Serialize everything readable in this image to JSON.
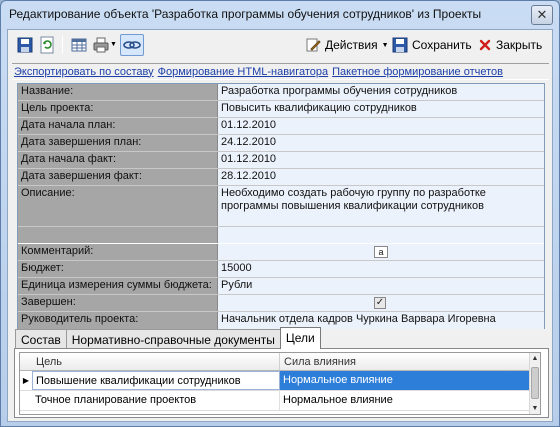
{
  "window": {
    "title": "Редактирование объекта 'Разработка программы обучения сотрудников' из Проекты",
    "close_glyph": "✕"
  },
  "toolbar": {
    "actions_label": "Действия",
    "save_label": "Сохранить",
    "close_label": "Закрыть",
    "icons": [
      "save-icon",
      "refresh-icon",
      "table-icon",
      "print-icon",
      "link-icon",
      "actions-icon",
      "save-icon",
      "close-icon"
    ]
  },
  "links": [
    "Экспортировать по составу",
    "Формирование HTML-навигатора",
    "Пакетное формирование отчетов"
  ],
  "properties": {
    "name": {
      "label": "Название:",
      "value": "Разработка программы обучения сотрудников"
    },
    "goal": {
      "label": "Цель проекта:",
      "value": "Повысить квалификацию сотрудников"
    },
    "start_plan": {
      "label": "Дата начала план:",
      "value": "01.12.2010"
    },
    "end_plan": {
      "label": "Дата завершения план:",
      "value": "24.12.2010"
    },
    "start_fact": {
      "label": "Дата начала факт:",
      "value": "01.12.2010"
    },
    "end_fact": {
      "label": "Дата завершения факт:",
      "value": "28.12.2010"
    },
    "description": {
      "label": "Описание:",
      "value": "Необходимо создать рабочую группу по разработке программы повышения квалификации сотрудников"
    },
    "comment": {
      "label": "Комментарий:",
      "value": "",
      "memo_glyph": "a"
    },
    "budget": {
      "label": "Бюджет:",
      "value": "15000"
    },
    "budget_unit": {
      "label": "Единица измерения суммы бюджета:",
      "value": "Рубли"
    },
    "completed": {
      "label": "Завершен:",
      "checked": true,
      "check_glyph": "✓"
    },
    "manager": {
      "label": "Руководитель проекта:",
      "value": "Начальник отдела кадров Чуркина Варвара Игоревна"
    }
  },
  "tabs": [
    "Состав",
    "Нормативно-справочные документы",
    "Цели"
  ],
  "active_tab": "Цели",
  "goals_table": {
    "columns": [
      "Цель",
      "Сила влияния"
    ],
    "rows": [
      {
        "goal": "Повышение квалификации сотрудников",
        "strength": "Нормальное влияние",
        "selected": true
      },
      {
        "goal": "Точное планирование проектов",
        "strength": "Нормальное влияние",
        "selected": false
      }
    ],
    "current_row_glyph": "▶"
  },
  "colors": {
    "title_gradient": "#c9dcf3",
    "label_bg": "#a6a6a6",
    "value_bg": "#ecf2fb",
    "link": "#1c3fa8",
    "selection": "#2d7ed8"
  }
}
